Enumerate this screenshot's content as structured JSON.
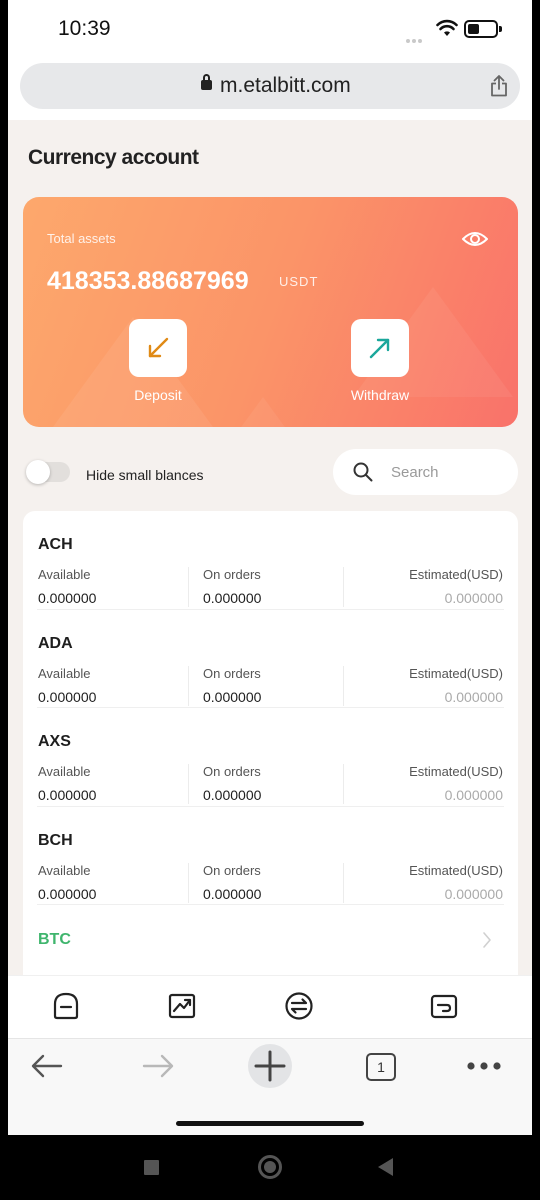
{
  "status_bar": {
    "time": "10:39"
  },
  "browser": {
    "url": "m.etalbitt.com",
    "open_tabs": "1"
  },
  "page": {
    "title": "Currency account"
  },
  "assets": {
    "label": "Total assets",
    "value": "418353.88687969",
    "unit": "USDT",
    "deposit_label": "Deposit",
    "withdraw_label": "Withdraw"
  },
  "filters": {
    "hide_small_label": "Hide small blances",
    "hide_small_enabled": false,
    "search_placeholder": "Search"
  },
  "columns": {
    "available": "Available",
    "on_orders": "On orders",
    "estimated": "Estimated(USD)"
  },
  "coins": [
    {
      "name": "ACH",
      "available": "0.000000",
      "on_orders": "0.000000",
      "estimated": "0.000000"
    },
    {
      "name": "ADA",
      "available": "0.000000",
      "on_orders": "0.000000",
      "estimated": "0.000000"
    },
    {
      "name": "AXS",
      "available": "0.000000",
      "on_orders": "0.000000",
      "estimated": "0.000000"
    },
    {
      "name": "BCH",
      "available": "0.000000",
      "on_orders": "0.000000",
      "estimated": "0.000000"
    },
    {
      "name": "BTC"
    }
  ],
  "colors": {
    "card_start": "#fda86c",
    "card_end": "#f9726a",
    "btc_green": "#3fb56d",
    "deposit_arrow": "#e08a16",
    "withdraw_arrow": "#1aa79b"
  },
  "icons": {
    "app_tabs": [
      "home-icon",
      "markets-chart-icon",
      "trade-exchange-icon",
      "wallet-icon"
    ],
    "browser": [
      "back-arrow-icon",
      "forward-arrow-icon",
      "new-tab-plus-icon",
      "tabs-icon",
      "more-menu-icon"
    ]
  }
}
